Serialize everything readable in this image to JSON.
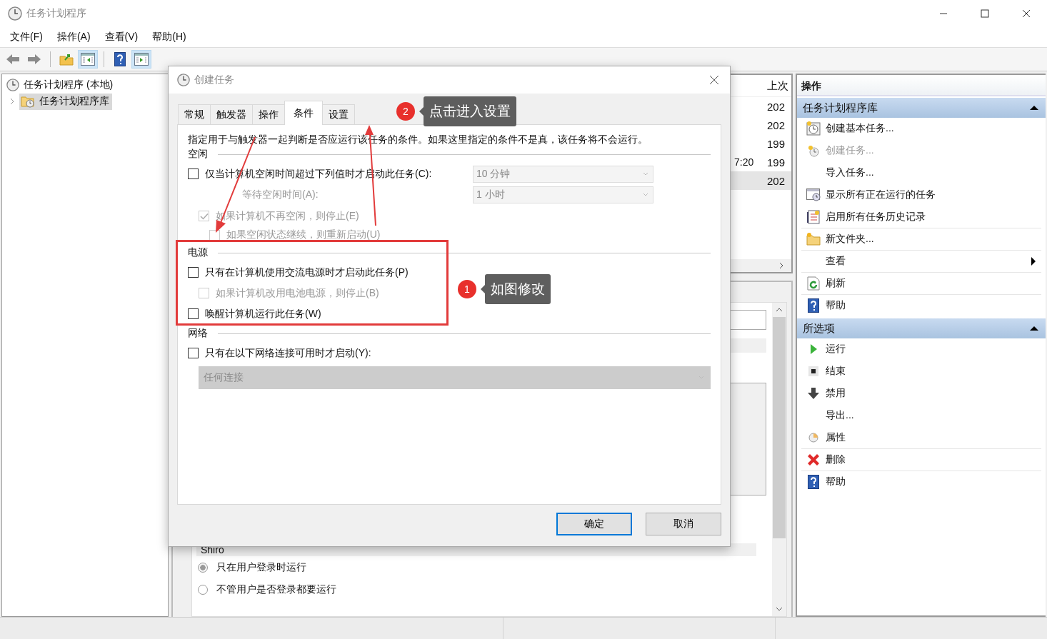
{
  "window": {
    "title": "任务计划程序"
  },
  "menu": [
    "文件(F)",
    "操作(A)",
    "查看(V)",
    "帮助(H)"
  ],
  "toolbar": [
    {
      "kind": "back",
      "on": false
    },
    {
      "kind": "forward",
      "on": false
    },
    {
      "kind": "up",
      "on": false
    },
    {
      "kind": "pane-left",
      "on": true
    },
    {
      "kind": "help",
      "on": false
    },
    {
      "kind": "pane-right",
      "on": true
    }
  ],
  "tree": [
    {
      "label": "任务计划程序 (本地)",
      "selected": false,
      "children": [
        {
          "label": "任务计划程序库",
          "selected": true,
          "expanded": false
        }
      ]
    }
  ],
  "task_list": {
    "column_2_header": "上次",
    "rows": [
      {
        "column_2": "202",
        "selected": false
      },
      {
        "column_2": "202",
        "selected": false
      },
      {
        "column_2": "199",
        "selected": false
      },
      {
        "column_1": "7:20",
        "column_2": "199",
        "selected": false
      },
      {
        "column_2": "202",
        "selected": true
      }
    ]
  },
  "security": {
    "user": "Shiro",
    "options": [
      {
        "label": "只在用户登录时运行",
        "selected": true
      },
      {
        "label": "不管用户是否登录都要运行",
        "selected": false
      }
    ]
  },
  "actions": {
    "title": "操作",
    "sections": [
      {
        "title": "任务计划程序库",
        "expanded": true,
        "items": [
          {
            "label": "创建基本任务...",
            "kind": "create-basic",
            "disabled": false,
            "separator": false,
            "submenu": false
          },
          {
            "label": "创建任务...",
            "kind": "create",
            "disabled": true,
            "separator": false,
            "submenu": false
          },
          {
            "label": "导入任务...",
            "kind": "plain",
            "disabled": false,
            "separator": false,
            "submenu": false
          },
          {
            "label": "显示所有正在运行的任务",
            "kind": "running",
            "disabled": false,
            "separator": false,
            "submenu": false
          },
          {
            "label": "启用所有任务历史记录",
            "kind": "history",
            "disabled": false,
            "separator": true,
            "submenu": false
          },
          {
            "label": "新文件夹...",
            "kind": "folder",
            "disabled": false,
            "separator": true,
            "submenu": false
          },
          {
            "label": "查看",
            "kind": "plain",
            "disabled": false,
            "separator": true,
            "submenu": true
          },
          {
            "label": "刷新",
            "kind": "refresh",
            "disabled": false,
            "separator": true,
            "submenu": false
          },
          {
            "label": "帮助",
            "kind": "help",
            "disabled": false,
            "separator": false,
            "submenu": false
          }
        ]
      },
      {
        "title": "所选项",
        "expanded": true,
        "items": [
          {
            "label": "运行",
            "kind": "run",
            "disabled": false,
            "separator": false,
            "submenu": false
          },
          {
            "label": "结束",
            "kind": "stop",
            "disabled": false,
            "separator": false,
            "submenu": false
          },
          {
            "label": "禁用",
            "kind": "disable",
            "disabled": false,
            "separator": false,
            "submenu": false
          },
          {
            "label": "导出...",
            "kind": "plain",
            "disabled": false,
            "separator": false,
            "submenu": false
          },
          {
            "label": "属性",
            "kind": "properties",
            "disabled": false,
            "separator": true,
            "submenu": false
          },
          {
            "label": "删除",
            "kind": "delete",
            "disabled": false,
            "separator": true,
            "submenu": false
          },
          {
            "label": "帮助",
            "kind": "help",
            "disabled": false,
            "separator": false,
            "submenu": false
          }
        ]
      }
    ]
  },
  "dialog": {
    "title": "创建任务",
    "tabs": [
      {
        "label": "常规",
        "selected": false
      },
      {
        "label": "触发器",
        "selected": false
      },
      {
        "label": "操作",
        "selected": false
      },
      {
        "label": "条件",
        "selected": true
      },
      {
        "label": "设置",
        "selected": false
      }
    ],
    "description": "指定用于与触发器一起判断是否应运行该任务的条件。如果这里指定的条件不是真，该任务将不会运行。",
    "sections": [
      {
        "title": "空闲",
        "items": [
          {
            "kind": "check",
            "label": "仅当计算机空闲时间超过下列值时才启动此任务(C):",
            "checked": false,
            "disabled": false,
            "dropdown": {
              "value": "10 分钟",
              "disabled": true
            },
            "children": [
              {
                "kind": "field",
                "label": "等待空闲时间(A):",
                "disabled": true,
                "value": "1 小时"
              },
              {
                "kind": "check",
                "label": "如果计算机不再空闲，则停止(E)",
                "checked": true,
                "disabled": true,
                "children": [
                  {
                    "kind": "check",
                    "label": "如果空闲状态继续，则重新启动(U)",
                    "checked": false,
                    "disabled": true
                  }
                ]
              }
            ]
          }
        ]
      },
      {
        "title": "电源",
        "items": [
          {
            "kind": "check",
            "label": "只有在计算机使用交流电源时才启动此任务(P)",
            "checked": false,
            "disabled": false,
            "children": [
              {
                "kind": "check",
                "label": "如果计算机改用电池电源，则停止(B)",
                "checked": false,
                "disabled": true
              }
            ]
          },
          {
            "kind": "check",
            "label": "唤醒计算机运行此任务(W)",
            "checked": false,
            "disabled": false
          }
        ]
      },
      {
        "title": "网络",
        "items": [
          {
            "kind": "check",
            "label": "只有在以下网络连接可用时才启动(Y):",
            "checked": false,
            "disabled": false,
            "children": [
              {
                "kind": "dropdown",
                "disabled": true,
                "value": "任何连接"
              }
            ]
          }
        ]
      }
    ],
    "buttons": [
      {
        "label": "确定",
        "default": true
      },
      {
        "label": "取消",
        "default": false
      }
    ]
  },
  "callouts": [
    {
      "number": "2",
      "text": "点击进入设置"
    },
    {
      "number": "1",
      "text": "如图修改"
    }
  ]
}
